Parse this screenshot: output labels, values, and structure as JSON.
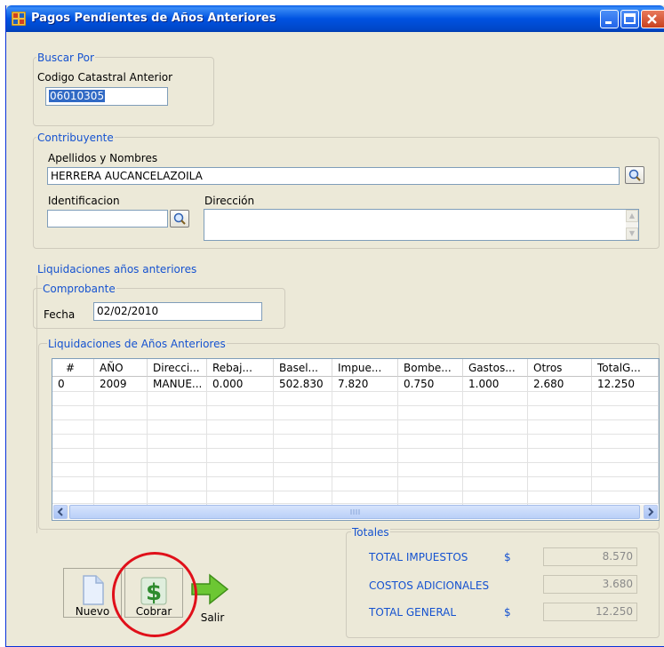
{
  "window": {
    "title": "Pagos Pendientes de Años Anteriores"
  },
  "buscar_por": {
    "legend": "Buscar Por",
    "codigo_label": "Codigo Catastral Anterior",
    "codigo_value": "06010305"
  },
  "contribuyente": {
    "legend": "Contribuyente",
    "apellidos_label": "Apellidos y Nombres",
    "apellidos_value": "HERRERA AUCANCELAZOILA",
    "identificacion_label": "Identificacion",
    "identificacion_value": "",
    "direccion_label": "Dirección",
    "direccion_value": ""
  },
  "liquidaciones": {
    "legend": "Liquidaciones años anteriores",
    "comprobante_legend": "Comprobante",
    "fecha_label": "Fecha",
    "fecha_value": "02/02/2010",
    "grid_legend": "Liquidaciones de Años Anteriores",
    "columns": [
      "#",
      "AÑO",
      "Direcci...",
      "Rebaj...",
      "Basel...",
      "Impue...",
      "Bombe...",
      "Gastos...",
      "Otros",
      "TotalG..."
    ],
    "rows": [
      [
        "0",
        "2009",
        "MANUE...",
        "0.000",
        "502.830",
        "7.820",
        "0.750",
        "1.000",
        "2.680",
        "12.250"
      ]
    ],
    "scroll_left_icon": "arrow-left-icon",
    "scroll_right_icon": "arrow-right-icon"
  },
  "totales": {
    "legend": "Totales",
    "impuestos_label": "TOTAL IMPUESTOS",
    "impuestos_currency": "$",
    "impuestos_value": "8.570",
    "costos_label": "COSTOS ADICIONALES",
    "costos_value": "3.680",
    "general_label": "TOTAL GENERAL",
    "general_currency": "$",
    "general_value": "12.250"
  },
  "buttons": {
    "nuevo": "Nuevo",
    "cobrar": "Cobrar",
    "salir": "Salir"
  },
  "colors": {
    "title_bar": "#0053e1",
    "group_label": "#1552d0",
    "highlight_circle": "#e0101a",
    "dollar_icon": "#2e8b2e",
    "arrow_icon": "#5bbd2a"
  }
}
